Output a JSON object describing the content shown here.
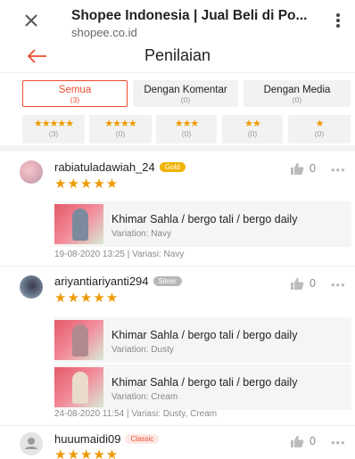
{
  "browser": {
    "title": "Shopee Indonesia | Jual Beli di Po...",
    "url": "shopee.co.id"
  },
  "header": {
    "title": "Penilaian"
  },
  "filters": {
    "tabs": [
      {
        "label": "Semua",
        "count": "(3)"
      },
      {
        "label": "Dengan Komentar",
        "count": "(0)"
      },
      {
        "label": "Dengan Media",
        "count": "(0)"
      }
    ],
    "stars": [
      {
        "stars": "★★★★★",
        "count": "(3)"
      },
      {
        "stars": "★★★★",
        "count": "(0)"
      },
      {
        "stars": "★★★",
        "count": "(0)"
      },
      {
        "stars": "★★",
        "count": "(0)"
      },
      {
        "stars": "★",
        "count": "(0)"
      }
    ]
  },
  "reviews": [
    {
      "username": "rabiatuladawiah_24",
      "badge": "Gold",
      "stars": "★★★★★",
      "likes": "0",
      "products": [
        {
          "name": "Khimar Sahla / bergo tali / bergo daily",
          "variation": "Variation: Navy"
        }
      ],
      "meta": "19-08-2020 13:25 | Variasi: Navy"
    },
    {
      "username": "ariyantiariyanti294",
      "badge": "Silver",
      "stars": "★★★★★",
      "likes": "0",
      "products": [
        {
          "name": "Khimar Sahla / bergo tali / bergo daily",
          "variation": "Variation: Dusty"
        },
        {
          "name": "Khimar Sahla / bergo tali / bergo daily",
          "variation": "Variation: Cream"
        }
      ],
      "meta": "24-08-2020 11:54 | Variasi: Dusty, Cream"
    },
    {
      "username": "huuumaidi09",
      "badge": "Classic",
      "stars": "★★★★★",
      "likes": "0"
    }
  ],
  "colors": {
    "accent": "#ee4d2d",
    "star": "#ee9a00"
  }
}
